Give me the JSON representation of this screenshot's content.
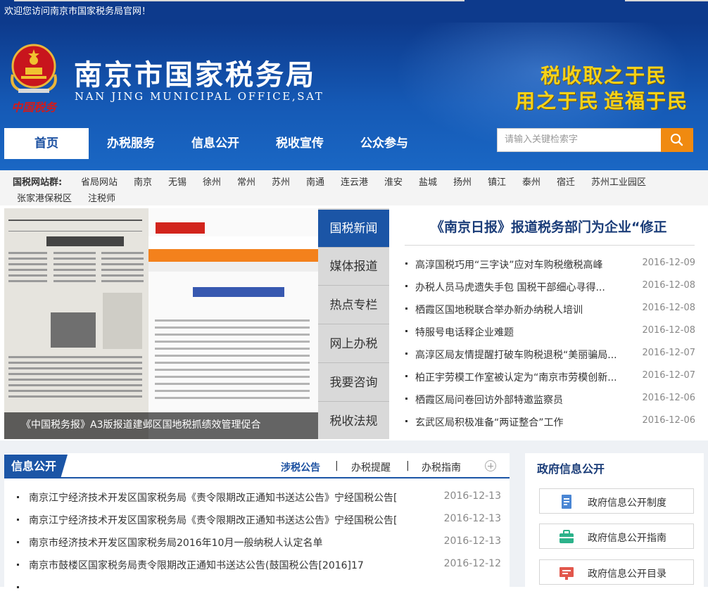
{
  "topbar": {
    "welcome": "欢迎您访问南京市国家税务局官网！"
  },
  "header": {
    "emblem_text": "中国税务",
    "title": "南京市国家税务局",
    "subtitle": "NAN JING MUNICIPAL OFFICE,SAT",
    "slogan_line1": "税收取之于民",
    "slogan_line2_a": "用之于民",
    "slogan_line2_b": "造福于民"
  },
  "nav": {
    "items": [
      "首页",
      "办税服务",
      "信息公开",
      "税收宣传",
      "公众参与"
    ],
    "active": "首页"
  },
  "search": {
    "placeholder": "请输入关键检索字"
  },
  "sites": {
    "label": "国税网站群:",
    "items": [
      "省局网站",
      "南京",
      "无锡",
      "徐州",
      "常州",
      "苏州",
      "南通",
      "连云港",
      "淮安",
      "盐城",
      "扬州",
      "镇江",
      "泰州",
      "宿迁",
      "苏州工业园区",
      "张家港保税区",
      "注税师"
    ]
  },
  "slideshow": {
    "caption": "《中国税务报》A3版报道建邺区国地税抓绩效管理促合"
  },
  "tabs": {
    "items": [
      "国税新闻",
      "媒体报道",
      "热点专栏",
      "网上办税",
      "我要咨询",
      "税收法规"
    ],
    "active": "国税新闻"
  },
  "news": {
    "headline": "《南京日报》报道税务部门为企业“修正",
    "items": [
      {
        "title": "高淳国税巧用“三字诀”应对车购税缴税高峰",
        "date": "2016-12-09"
      },
      {
        "title": "办税人员马虎遗失手包 国税干部细心寻得...",
        "date": "2016-12-08"
      },
      {
        "title": "栖霞区国地税联合举办新办纳税人培训",
        "date": "2016-12-08"
      },
      {
        "title": "特服号电话释企业难题",
        "date": "2016-12-08"
      },
      {
        "title": "高淳区局友情提醒打破车购税退税“美丽骗局...",
        "date": "2016-12-07"
      },
      {
        "title": "柏正宇劳模工作室被认定为“南京市劳模创新...",
        "date": "2016-12-07"
      },
      {
        "title": "栖霞区局问卷回访外部特邀监察员",
        "date": "2016-12-06"
      },
      {
        "title": "玄武区局积极准备“两证整合”工作",
        "date": "2016-12-06"
      }
    ]
  },
  "info": {
    "title": "信息公开",
    "tabs": [
      "涉税公告",
      "办税提醒",
      "办税指南"
    ],
    "separator": "|",
    "items": [
      {
        "title": "南京江宁经济技术开发区国家税务局《责令限期改正通知书送达公告》宁经国税公告[",
        "date": "2016-12-13"
      },
      {
        "title": "南京江宁经济技术开发区国家税务局《责令限期改正通知书送达公告》宁经国税公告[",
        "date": "2016-12-13"
      },
      {
        "title": "南京市经济技术开发区国家税务局2016年10月一般纳税人认定名单",
        "date": "2016-12-13"
      },
      {
        "title": "南京市鼓楼区国家税务局责令限期改正通知书送达公告(鼓国税公告[2016]17",
        "date": "2016-12-12"
      }
    ]
  },
  "gov": {
    "title": "政府信息公开",
    "buttons": [
      "政府信息公开制度",
      "政府信息公开指南",
      "政府信息公开目录"
    ]
  }
}
